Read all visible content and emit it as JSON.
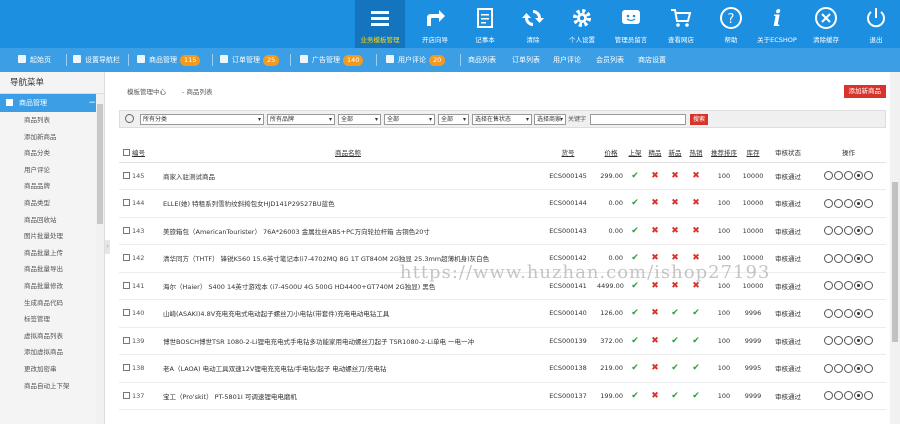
{
  "topbar": {
    "items": [
      {
        "label": "业务模板管理",
        "icon": "menu-icon",
        "active": true
      },
      {
        "label": "开店向导",
        "icon": "share-icon"
      },
      {
        "label": "记事本",
        "icon": "note-icon"
      },
      {
        "label": "清除",
        "icon": "refresh-icon"
      },
      {
        "label": "个人设置",
        "icon": "gear-icon"
      },
      {
        "label": "管理员留言",
        "icon": "message-icon"
      },
      {
        "label": "查看网店",
        "icon": "cart-icon"
      },
      {
        "label": "帮助",
        "icon": "help-icon"
      },
      {
        "label": "关于ECSHOP",
        "icon": "info-icon"
      },
      {
        "label": "清除缓存",
        "icon": "close-icon"
      },
      {
        "label": "退出",
        "icon": "power-icon"
      }
    ]
  },
  "navbar": {
    "items": [
      {
        "label": "起始页",
        "badge": ""
      },
      {
        "label": "设置导航栏",
        "badge": ""
      },
      {
        "label": "商品管理",
        "badge": "115"
      },
      {
        "label": "订单管理",
        "badge": "25"
      },
      {
        "label": "广告管理",
        "badge": "140"
      },
      {
        "label": "用户评论",
        "badge": "20"
      }
    ],
    "links": [
      "商品列表",
      "订单列表",
      "用户评论",
      "会员列表",
      "商店设置"
    ]
  },
  "sidebar": {
    "title": "导航菜单",
    "group": "商品管理",
    "items": [
      "商品列表",
      "添加新商品",
      "商品分类",
      "用户评论",
      "商品品牌",
      "商品类型",
      "商品回收站",
      "图片批量处理",
      "商品批量上传",
      "商品批量导出",
      "商品批量修改",
      "生成商品代码",
      "标签管理",
      "虚拟商品列表",
      "添加虚拟商品",
      "更改加密串",
      "商品自动上下架"
    ]
  },
  "main": {
    "breadcrumb": [
      "模板管理中心",
      "- 商品列表"
    ],
    "add_button": "添加新商品",
    "filters": [
      "所有分类",
      "所有品牌",
      "全部",
      "全部",
      "全部",
      "选择在售状态",
      "选择商家"
    ],
    "keyword_label": "关键字",
    "keyword_value": "",
    "search_button": "搜索",
    "columns": [
      "编号",
      "商品名称",
      "货号",
      "价格",
      "上架",
      "精品",
      "新品",
      "热销",
      "推荐排序",
      "库存",
      "审核状态",
      "操作"
    ],
    "rows": [
      {
        "id": "145",
        "name": "商家入驻测试商品",
        "sn": "ECS000145",
        "price": "299.00",
        "onsale": true,
        "best": false,
        "new": false,
        "hot": false,
        "sort": "100",
        "stock": "10000",
        "review": "审核通过"
      },
      {
        "id": "144",
        "name": "ELLE(她) 特租系列雪豹纹斜挎包女HJD141P29527BU蓝色",
        "sn": "ECS000144",
        "price": "0.00",
        "onsale": true,
        "best": false,
        "new": false,
        "hot": false,
        "sort": "100",
        "stock": "10000",
        "review": "审核通过"
      },
      {
        "id": "143",
        "name": "美旅箱包（AmericanTourister） 76A*26003 金属拉丝ABS+PC万向轮拉杆箱 古铜色20寸",
        "sn": "ECS000143",
        "price": "0.00",
        "onsale": true,
        "best": false,
        "new": false,
        "hot": false,
        "sort": "100",
        "stock": "10000",
        "review": "审核通过"
      },
      {
        "id": "142",
        "name": "清华同方（THTF） 锋锐K560 15.6英寸笔记本(i7-4702MQ 8G 1T GT840M 2G独显 25.3mm超薄机身)灰白色",
        "sn": "ECS000142",
        "price": "0.00",
        "onsale": true,
        "best": false,
        "new": false,
        "hot": false,
        "sort": "100",
        "stock": "10000",
        "review": "审核通过"
      },
      {
        "id": "141",
        "name": "海尔（Haier） S400 14英寸游戏本 (i7-4500U 4G 500G HD4400+GT740M 2G独显) 黑色",
        "sn": "ECS000141",
        "price": "4499.00",
        "onsale": true,
        "best": false,
        "new": false,
        "hot": false,
        "sort": "100",
        "stock": "10000",
        "review": "审核通过"
      },
      {
        "id": "140",
        "name": "山崎(ASAKI)4.8V充电充电式电动起子螺丝刀小电钻(带套件)充电电动电钻工具",
        "sn": "ECS000140",
        "price": "126.00",
        "onsale": true,
        "best": false,
        "new": true,
        "hot": true,
        "sort": "100",
        "stock": "9996",
        "review": "审核通过"
      },
      {
        "id": "139",
        "name": "博世BOSCH博世TSR 1080-2-Li锂电充电式手电钻多功能家用电动螺丝刀起子 TSR1080-2-Li单电 一电一冲",
        "sn": "ECS000139",
        "price": "372.00",
        "onsale": true,
        "best": false,
        "new": true,
        "hot": true,
        "sort": "100",
        "stock": "9999",
        "review": "审核通过"
      },
      {
        "id": "138",
        "name": "老A（LAOA) 电动工具双速12V锂电充充电钻/手电钻/起子 电动螺丝刀/充电钻",
        "sn": "ECS000138",
        "price": "219.00",
        "onsale": true,
        "best": false,
        "new": true,
        "hot": true,
        "sort": "100",
        "stock": "9995",
        "review": "审核通过"
      },
      {
        "id": "137",
        "name": "宝工（Pro'skit） PT-5801I 可调速锂电电磨机",
        "sn": "ECS000137",
        "price": "199.00",
        "onsale": true,
        "best": false,
        "new": true,
        "hot": true,
        "sort": "100",
        "stock": "9999",
        "review": "审核通过"
      }
    ]
  },
  "watermark": "https://www.huzhan.com/ishop27193",
  "colors": {
    "primary": "#1d8fe0",
    "nav": "#3c9fe6",
    "badge": "#f39a1e",
    "danger": "#d9342b",
    "yes": "#2a9d3b"
  }
}
